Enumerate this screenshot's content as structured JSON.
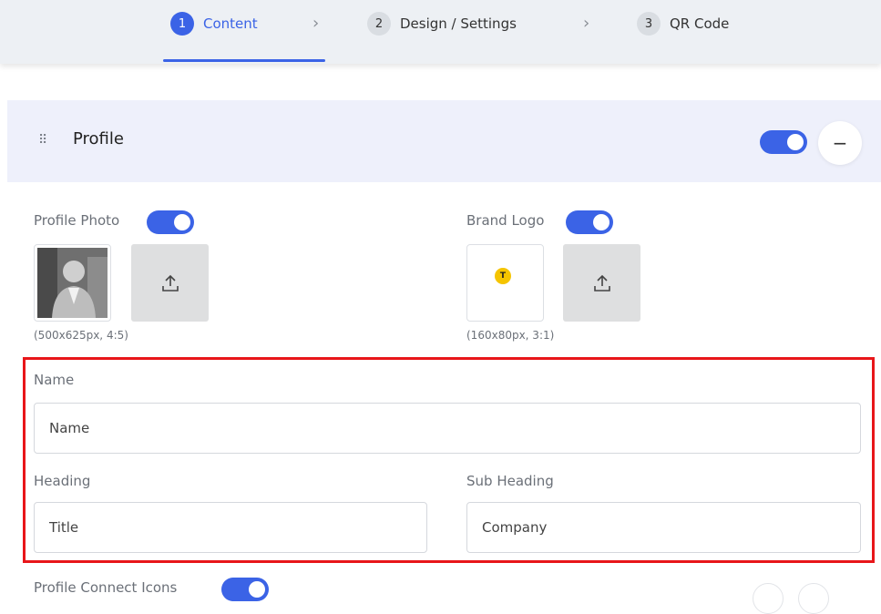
{
  "stepper": {
    "steps": [
      {
        "num": "1",
        "label": "Content"
      },
      {
        "num": "2",
        "label": "Design / Settings"
      },
      {
        "num": "3",
        "label": "QR Code"
      }
    ],
    "chevron": "›"
  },
  "profile_card": {
    "title": "Profile",
    "enabled": true
  },
  "profile_photo": {
    "label": "Profile Photo",
    "enabled": true,
    "hint": "(500x625px, 4:5)"
  },
  "brand_logo": {
    "label": "Brand Logo",
    "enabled": true,
    "hint": "(160x80px, 3:1)",
    "logo_letter": "T"
  },
  "fields": {
    "name": {
      "label": "Name",
      "value": "Name"
    },
    "heading": {
      "label": "Heading",
      "value": "Title"
    },
    "sub_heading": {
      "label": "Sub Heading",
      "value": "Company"
    }
  },
  "connect_icons": {
    "label": "Profile Connect Icons",
    "enabled": true
  },
  "colors": {
    "accent": "#3b63e6",
    "highlight": "#e8161a"
  },
  "icons": [
    "drag-handle-icon",
    "upload-icon",
    "minus-icon",
    "chevron-right-icon"
  ]
}
